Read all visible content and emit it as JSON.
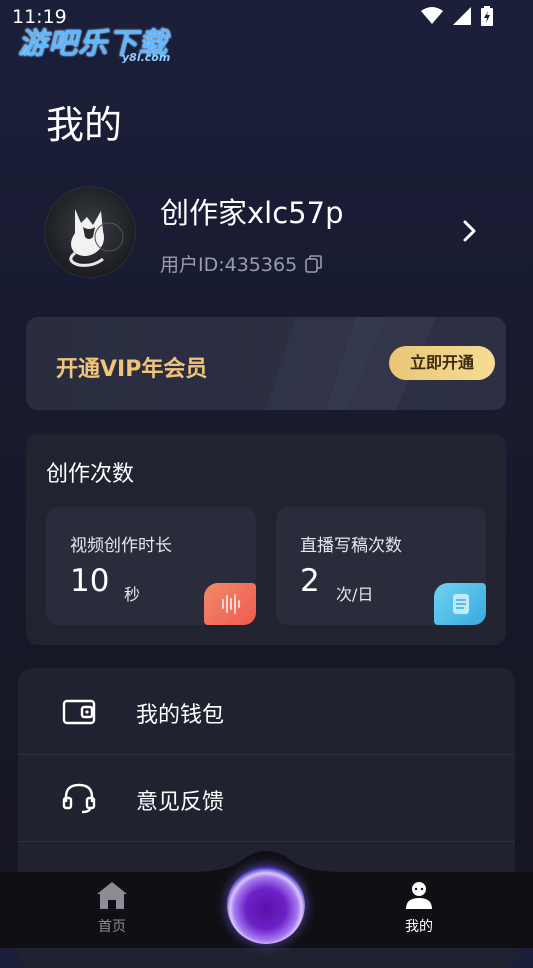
{
  "status_bar": {
    "time": "11:19"
  },
  "watermark": {
    "main": "游吧乐下载",
    "sub": "y8l.com"
  },
  "header": {
    "title": "我的"
  },
  "profile": {
    "name": "创作家xlc57p",
    "user_id": "用户ID:435365"
  },
  "vip": {
    "text": "开通VIP年会员",
    "button_label": "立即开通"
  },
  "credits": {
    "title": "创作次数",
    "items": [
      {
        "label": "视频创作时长",
        "value": "10",
        "unit": "秒",
        "badge_color": "#f0715a"
      },
      {
        "label": "直播写稿次数",
        "value": "2",
        "unit": "次/日",
        "badge_color": "#4bb8e6"
      }
    ]
  },
  "menu": {
    "items": [
      {
        "label": "我的钱包",
        "icon": "wallet-icon"
      },
      {
        "label": "意见反馈",
        "icon": "headset-icon"
      }
    ]
  },
  "tabbar": {
    "items": [
      {
        "label": "首页",
        "icon": "home-icon",
        "active": false
      },
      {
        "label": "我的",
        "icon": "user-icon",
        "active": true
      }
    ]
  },
  "colors": {
    "vip_gold": "#f0c57a",
    "background": "#181b30",
    "card": "#212330"
  }
}
